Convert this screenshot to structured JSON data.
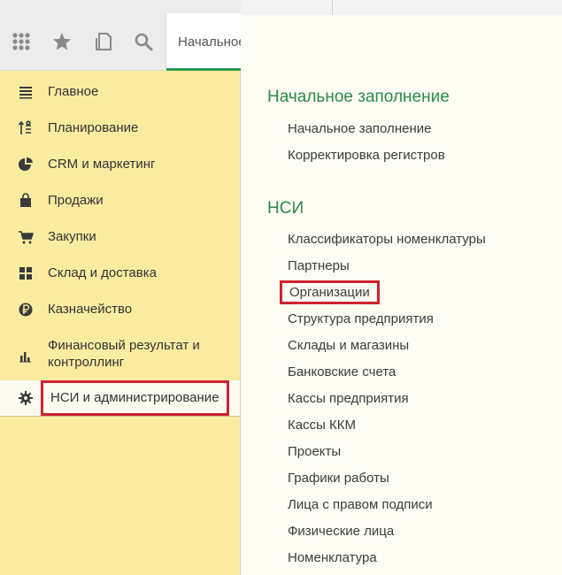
{
  "toolbar": {
    "tab_label": "Начальное заполнение"
  },
  "sidebar": {
    "items": [
      {
        "label": "Главное"
      },
      {
        "label": "Планирование"
      },
      {
        "label": "CRM и маркетинг"
      },
      {
        "label": "Продажи"
      },
      {
        "label": "Закупки"
      },
      {
        "label": "Склад и доставка"
      },
      {
        "label": "Казначейство"
      },
      {
        "label_line1": "Финансовый результат и",
        "label_line2": "контроллинг"
      },
      {
        "label": "НСИ и администрирование"
      }
    ]
  },
  "content": {
    "section1": {
      "title": "Начальное заполнение",
      "links": [
        "Начальное заполнение",
        "Корректировка регистров"
      ]
    },
    "section2": {
      "title": "НСИ",
      "links": [
        "Классификаторы номенклатуры",
        "Партнеры",
        "Организации",
        "Структура предприятия",
        "Склады и магазины",
        "Банковские счета",
        "Кассы предприятия",
        "Кассы ККМ",
        "Проекты",
        "Графики работы",
        "Лица с правом подписи",
        "Физические лица",
        "Номенклатура"
      ]
    }
  },
  "colors": {
    "accent_green": "#2b8a4a",
    "highlight_red": "#d0222e",
    "sidebar_bg": "#f9eca0"
  },
  "icons": [
    "apps-grid-icon",
    "star-icon",
    "history-icon",
    "search-icon",
    "menu-lines-icon",
    "planning-icon",
    "pie-chart-icon",
    "shopping-bag-icon",
    "cart-icon",
    "warehouse-icon",
    "ruble-coin-icon",
    "bar-chart-icon",
    "gear-icon"
  ]
}
